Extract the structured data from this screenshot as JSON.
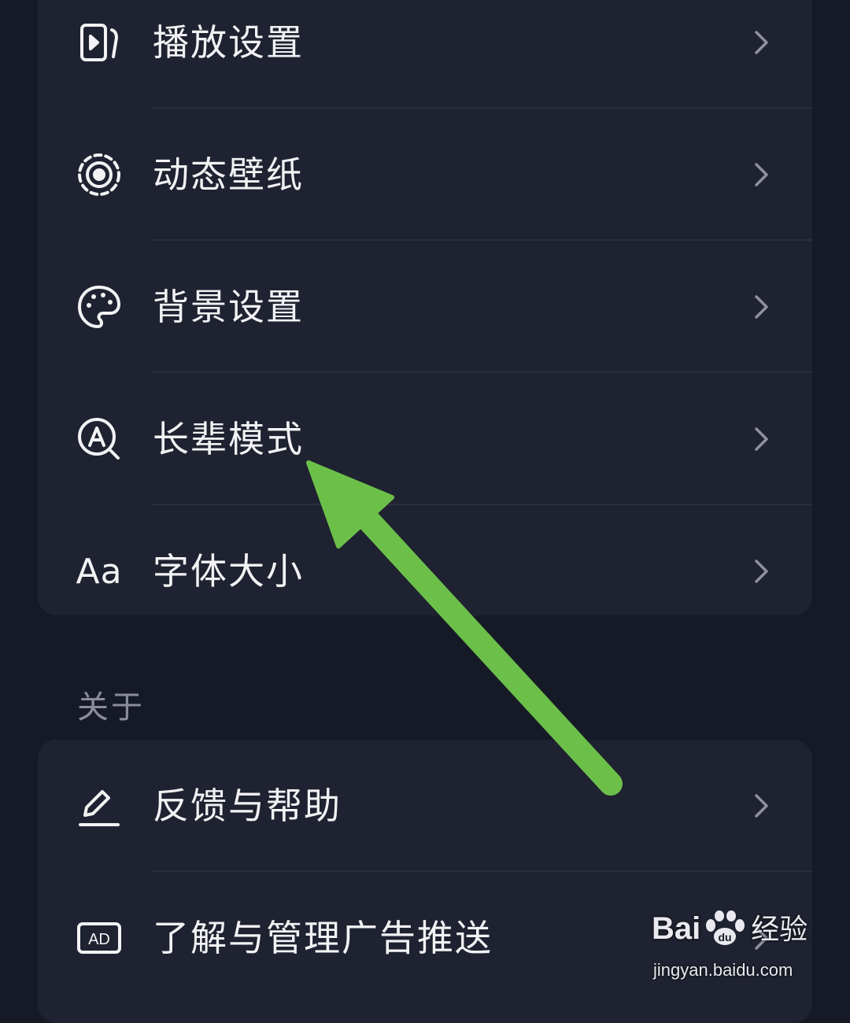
{
  "settings_group": {
    "items": [
      {
        "label": "播放设置",
        "icon": "play-settings-icon"
      },
      {
        "label": "动态壁纸",
        "icon": "live-wallpaper-icon"
      },
      {
        "label": "背景设置",
        "icon": "palette-icon"
      },
      {
        "label": "长辈模式",
        "icon": "elder-mode-icon"
      },
      {
        "label": "字体大小",
        "icon": "font-size-icon",
        "icon_text": "Aa"
      }
    ]
  },
  "about_section": {
    "title": "关于",
    "items": [
      {
        "label": "反馈与帮助",
        "icon": "edit-icon"
      },
      {
        "label": "了解与管理广告推送",
        "icon": "ad-icon",
        "icon_text": "AD"
      }
    ]
  },
  "watermark": {
    "brand": "Bai",
    "brand_suffix": "经验",
    "url": "jingyan.baidu.com"
  },
  "colors": {
    "background": "#161a26",
    "card": "#1f2230",
    "arrow": "#6cc04a",
    "section_title": "#8a8d99"
  }
}
